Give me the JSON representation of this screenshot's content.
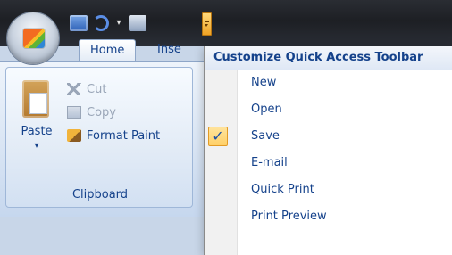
{
  "ribbon": {
    "tabs": [
      "Home",
      "Inse"
    ],
    "clipboard": {
      "paste_label": "Paste",
      "cut_label": "Cut",
      "copy_label": "Copy",
      "format_paint_label": "Format Paint",
      "group_label": "Clipboard"
    }
  },
  "quick_access_menu": {
    "title": "Customize Quick Access Toolbar",
    "items": [
      {
        "label": "New",
        "checked": false
      },
      {
        "label": "Open",
        "checked": false
      },
      {
        "label": "Save",
        "checked": true,
        "checkmark": "✓"
      },
      {
        "label": "E-mail",
        "checked": false
      },
      {
        "label": "Quick Print",
        "checked": false
      },
      {
        "label": "Print Preview",
        "checked": false
      }
    ]
  },
  "icons": {
    "office_button": "office-logo-icon",
    "qat": [
      "save-icon",
      "undo-icon",
      "chevron-down-icon",
      "print-icon"
    ],
    "customize": "customize-quick-access-icon",
    "clipboard": [
      "paste-icon",
      "cut-icon",
      "copy-icon",
      "format-painter-icon"
    ]
  },
  "colors": {
    "accent_text": "#15428b",
    "menu_check_bg": "#ffd067",
    "ribbon_bg": "#d9e5f4",
    "titlebar": "#1d1f24"
  }
}
